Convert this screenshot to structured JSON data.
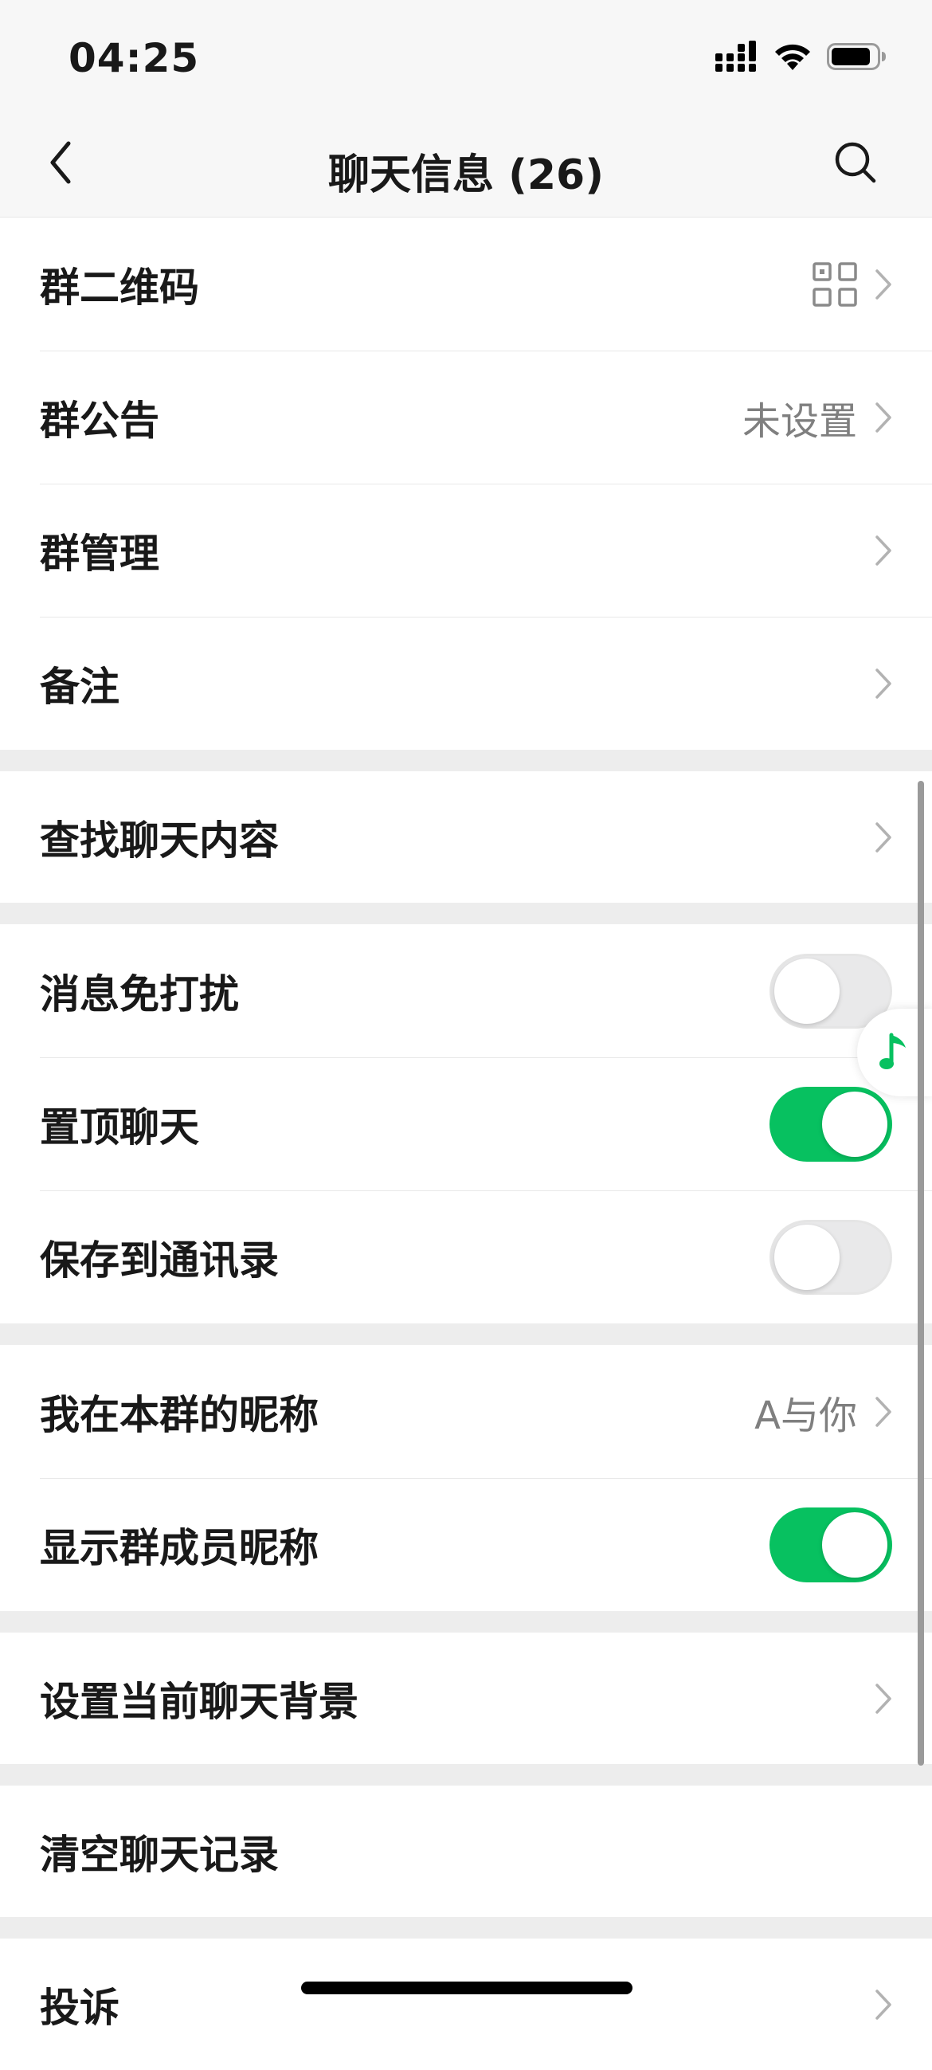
{
  "status_bar": {
    "time": "04:25",
    "icons": [
      "signal-icon",
      "wifi-icon",
      "battery-icon"
    ]
  },
  "nav": {
    "title": "聊天信息 (26)",
    "back_icon": "chevron-left-icon",
    "search_icon": "search-icon"
  },
  "settings": {
    "qr_code": {
      "label": "群二维码",
      "icon": "qr-code-icon"
    },
    "announcement": {
      "label": "群公告",
      "value": "未设置"
    },
    "management": {
      "label": "群管理"
    },
    "remark": {
      "label": "备注"
    },
    "search_content": {
      "label": "查找聊天内容"
    },
    "mute": {
      "label": "消息免打扰",
      "enabled": false
    },
    "pin": {
      "label": "置顶聊天",
      "enabled": true
    },
    "save_contacts": {
      "label": "保存到通讯录",
      "enabled": false
    },
    "my_nickname": {
      "label": "我在本群的昵称",
      "value": "A与你"
    },
    "show_nicknames": {
      "label": "显示群成员昵称",
      "enabled": true
    },
    "background": {
      "label": "设置当前聊天背景"
    },
    "clear_history": {
      "label": "清空聊天记录"
    },
    "report": {
      "label": "投诉"
    }
  },
  "floating": {
    "icon": "music-note-icon"
  },
  "colors": {
    "accent_green": "#07c160",
    "background": "#ededed",
    "text_primary": "#191919",
    "text_secondary": "#7f7f7f"
  }
}
